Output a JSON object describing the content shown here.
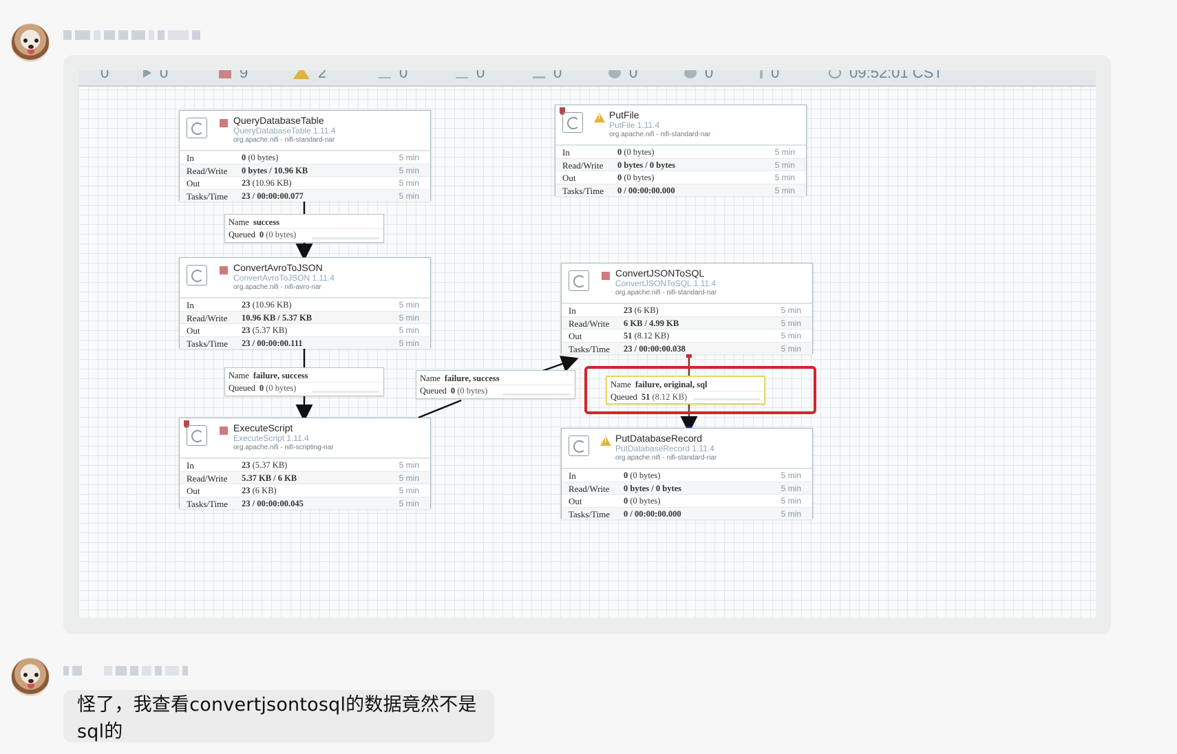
{
  "chat": {
    "message_text": "怪了，我查看convertjsontosql的数据竟然不是sql的"
  },
  "toolbar": {
    "items": [
      {
        "icon": "transmitting-icon",
        "value": "0"
      },
      {
        "icon": "running-icon",
        "value": "0"
      },
      {
        "icon": "stopped-icon",
        "value": "9"
      },
      {
        "icon": "invalid-warning-icon",
        "value": "2"
      },
      {
        "icon": "disabled-icon",
        "value": "0"
      },
      {
        "icon": "up-to-date-icon",
        "value": "0"
      },
      {
        "icon": "locally-modified-icon",
        "value": "0"
      },
      {
        "icon": "stale-icon",
        "value": "0"
      },
      {
        "icon": "sync-failure-icon",
        "value": "0"
      },
      {
        "icon": "errors-icon",
        "value": "0"
      },
      {
        "icon": "refresh-icon",
        "value": "09:52:01 CST"
      }
    ]
  },
  "processors": [
    {
      "id": "query",
      "name": "QueryDatabaseTable",
      "type": "QueryDatabaseTable 1.11.4",
      "bundle": "org.apache.nifi - nifi-standard-nar",
      "status": "stopped",
      "in_val": "0",
      "in_sz": "(0 bytes)",
      "rw": "0 bytes / 10.96 KB",
      "out_val": "23",
      "out_sz": "(10.96 KB)",
      "tasks": "23 / 00:00:00.077",
      "window": "5 min"
    },
    {
      "id": "avro",
      "name": "ConvertAvroToJSON",
      "type": "ConvertAvroToJSON 1.11.4",
      "bundle": "org.apache.nifi - nifi-avro-nar",
      "status": "stopped",
      "in_val": "23",
      "in_sz": "(10.96 KB)",
      "rw": "10.96 KB / 5.37 KB",
      "out_val": "23",
      "out_sz": "(5.37 KB)",
      "tasks": "23 / 00:00:00.111",
      "window": "5 min"
    },
    {
      "id": "script",
      "name": "ExecuteScript",
      "type": "ExecuteScript 1.11.4",
      "bundle": "org.apache.nifi - nifi-scripting-nar",
      "status": "stopped",
      "in_val": "23",
      "in_sz": "(5.37 KB)",
      "rw": "5.37 KB / 6 KB",
      "out_val": "23",
      "out_sz": "(6 KB)",
      "tasks": "23 / 00:00:00.045",
      "window": "5 min"
    },
    {
      "id": "putfile",
      "name": "PutFile",
      "type": "PutFile 1.11.4",
      "bundle": "org.apache.nifi - nifi-standard-nar",
      "status": "invalid",
      "in_val": "0",
      "in_sz": "(0 bytes)",
      "rw": "0 bytes / 0 bytes",
      "out_val": "0",
      "out_sz": "(0 bytes)",
      "tasks": "0 / 00:00:00.000",
      "window": "5 min"
    },
    {
      "id": "jsonsql",
      "name": "ConvertJSONToSQL",
      "type": "ConvertJSONToSQL 1.11.4",
      "bundle": "org.apache.nifi - nifi-standard-nar",
      "status": "stopped",
      "in_val": "23",
      "in_sz": "(6 KB)",
      "rw": "6 KB / 4.99 KB",
      "out_val": "51",
      "out_sz": "(8.12 KB)",
      "tasks": "23 / 00:00:00.038",
      "window": "5 min"
    },
    {
      "id": "putdb",
      "name": "PutDatabaseRecord",
      "type": "PutDatabaseRecord 1.11.4",
      "bundle": "org.apache.nifi - nifi-standard-nar",
      "status": "invalid",
      "in_val": "0",
      "in_sz": "(0 bytes)",
      "rw": "0 bytes / 0 bytes",
      "out_val": "0",
      "out_sz": "(0 bytes)",
      "tasks": "0 / 00:00:00.000",
      "window": "5 min"
    }
  ],
  "row_labels": {
    "in": "In",
    "rw": "Read/Write",
    "out": "Out",
    "tasks": "Tasks/Time"
  },
  "conn_labels": {
    "name": "Name",
    "queued": "Queued"
  },
  "connections": [
    {
      "name": "success",
      "queued_val": "0",
      "queued_sz": "(0 bytes)"
    },
    {
      "name": "failure, success",
      "queued_val": "0",
      "queued_sz": "(0 bytes)"
    },
    {
      "name": "failure, success",
      "queued_val": "0",
      "queued_sz": "(0 bytes)"
    },
    {
      "name": "failure, original, sql",
      "queued_val": "51",
      "queued_sz": "(8.12 KB)"
    }
  ]
}
